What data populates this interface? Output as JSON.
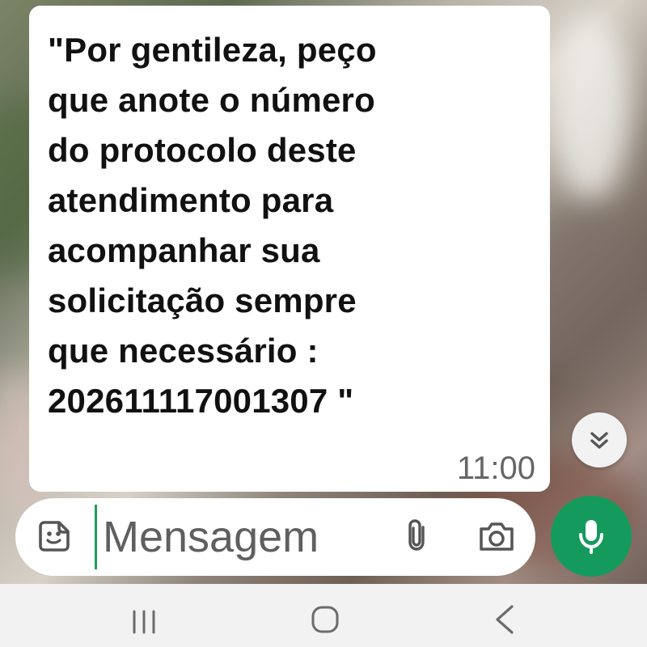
{
  "conversation": {
    "message": {
      "text": "\"Por gentileza, peço\nque anote o número\ndo protocolo deste\natendimento para\nacompanhar sua\nsolicitação sempre\nque necessário :\n202611117001307 \"",
      "time": "11:00"
    },
    "scroll_down_icon": "double-chevron-down-icon"
  },
  "composer": {
    "input": {
      "value": "",
      "placeholder": "Mensagem"
    },
    "icons": {
      "emoji": "emoji-icon",
      "attach": "paperclip-icon",
      "camera": "camera-icon",
      "mic": "microphone-icon"
    }
  },
  "navigation": {
    "recent_apps_icon": "recent-apps-icon",
    "home_icon": "home-icon",
    "back_icon": "back-icon"
  },
  "colors": {
    "mic_button": "#159a5d",
    "cursor": "#1f9f5b",
    "message_bubble": "#ffffff",
    "composer": "#ffffff",
    "nav_bar": "#f2f2f2"
  }
}
